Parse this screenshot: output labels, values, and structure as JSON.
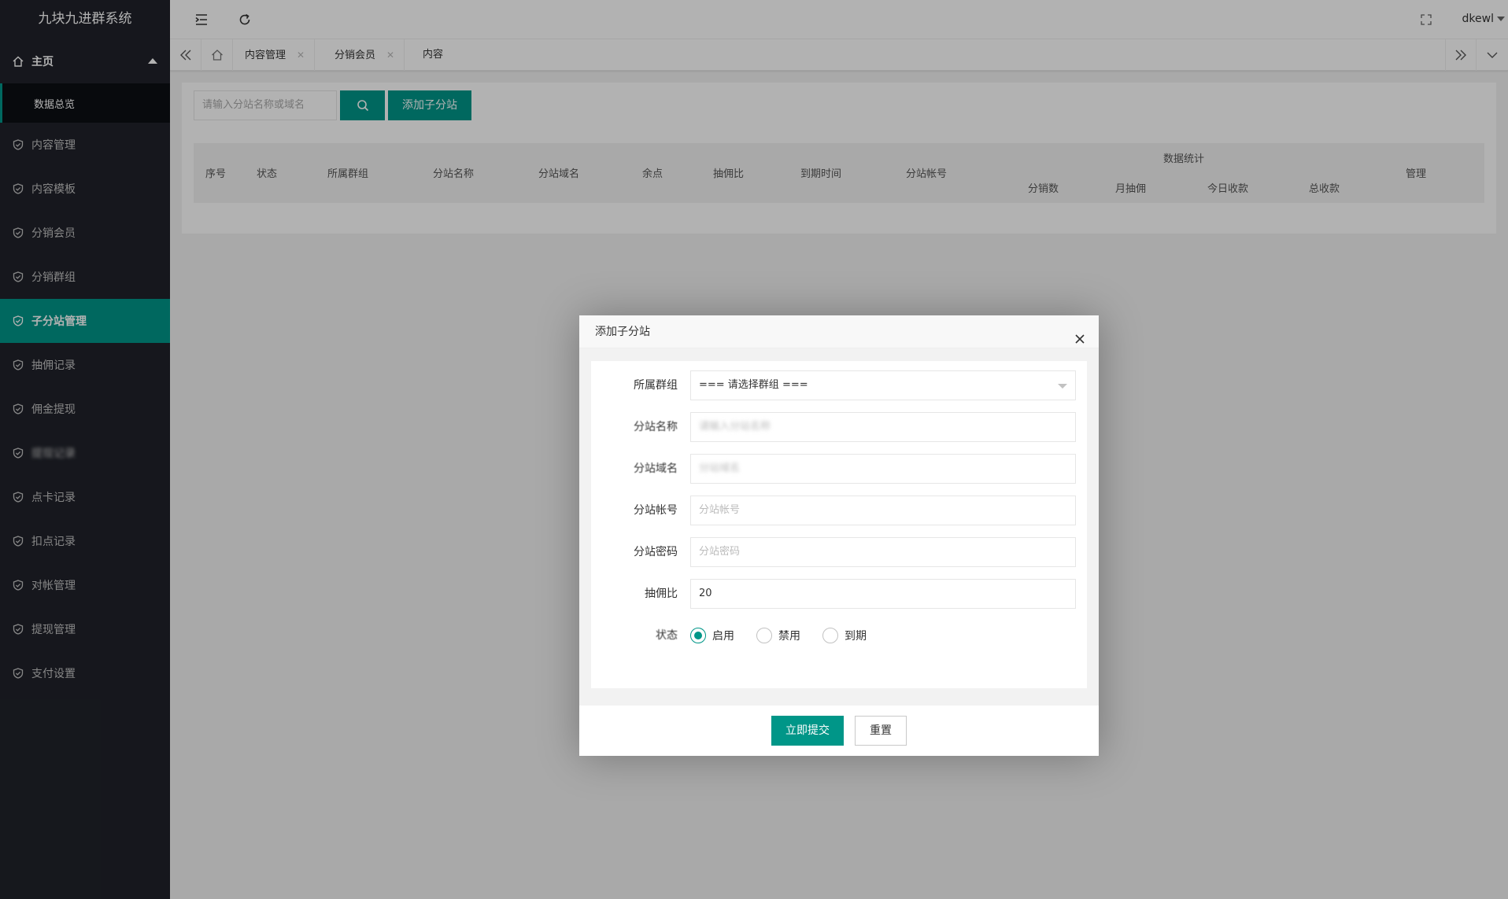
{
  "app": {
    "title": "九块九进群系统"
  },
  "sidebar": {
    "home": {
      "label": "主页",
      "icon": "home-icon"
    },
    "home_sub": {
      "label": "数据总览"
    },
    "items": [
      {
        "label": "内容管理",
        "icon": "shield-icon"
      },
      {
        "label": "内容模板",
        "icon": "shield-icon"
      },
      {
        "label": "分销会员",
        "icon": "shield-icon"
      },
      {
        "label": "分销群组",
        "icon": "shield-icon"
      },
      {
        "label": "子分站管理",
        "icon": "shield-icon",
        "active": true
      },
      {
        "label": "抽佣记录",
        "icon": "shield-icon"
      },
      {
        "label": "佣金提现",
        "icon": "shield-icon"
      },
      {
        "label": "提现记录",
        "icon": "shield-icon"
      },
      {
        "label": "点卡记录",
        "icon": "shield-icon"
      },
      {
        "label": "扣点记录",
        "icon": "shield-icon"
      },
      {
        "label": "对帐管理",
        "icon": "shield-icon"
      },
      {
        "label": "提现管理",
        "icon": "shield-icon"
      },
      {
        "label": "支付设置",
        "icon": "shield-icon"
      }
    ]
  },
  "header": {
    "user": "dkewl"
  },
  "tabs": [
    {
      "label": "内容管理"
    },
    {
      "label": "分销会员"
    },
    {
      "label": "内容"
    }
  ],
  "toolbar": {
    "search_placeholder": "请输入分站名称或域名",
    "add_label": "添加子分站"
  },
  "table": {
    "columns": [
      "序号",
      "状态",
      "所属群组",
      "分站名称",
      "分站域名",
      "余点",
      "抽佣比",
      "到期时间",
      "分站帐号"
    ],
    "group_header": "数据统计",
    "group_columns": [
      "分销数",
      "月抽佣",
      "今日收款",
      "总收款"
    ],
    "manage": "管理"
  },
  "dialog": {
    "title": "添加子分站",
    "fields": {
      "group": {
        "label": "所属群组",
        "value": "=== 请选择群组 ==="
      },
      "name": {
        "label": "分站名称",
        "placeholder": "请输入分站名称"
      },
      "domain": {
        "label": "分站域名",
        "placeholder": "分站域名"
      },
      "account": {
        "label": "分站帐号",
        "placeholder": "分站帐号"
      },
      "password": {
        "label": "分站密码",
        "placeholder": "分站密码"
      },
      "ratio": {
        "label": "抽佣比",
        "value": "20"
      },
      "status": {
        "label": "状态",
        "options": [
          "启用",
          "禁用",
          "到期"
        ],
        "selected": "启用"
      }
    },
    "submit_label": "立即提交",
    "reset_label": "重置"
  },
  "colors": {
    "accent": "#009688",
    "sidebar_bg": "#20222a"
  }
}
